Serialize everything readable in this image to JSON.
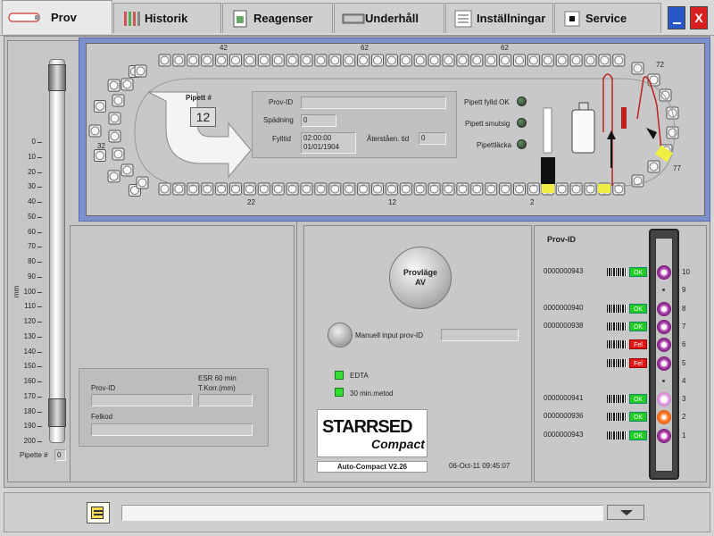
{
  "tabs": [
    {
      "label": "Prov",
      "icon": "sample-tube-icon"
    },
    {
      "label": "Historik",
      "icon": "tubes-history-icon"
    },
    {
      "label": "Reagenser",
      "icon": "reagent-doc-icon"
    },
    {
      "label": "Underhåll",
      "icon": "maintenance-icon"
    },
    {
      "label": "Inställningar",
      "icon": "settings-list-icon"
    },
    {
      "label": "Service",
      "icon": "service-icon"
    }
  ],
  "window": {
    "minimize_icon": "minimize-icon",
    "close_label": "X"
  },
  "conveyor": {
    "top_labels": [
      "42",
      "62",
      "62",
      "72"
    ],
    "left_label": "32",
    "bottom_labels": [
      "22",
      "12",
      "2"
    ],
    "right_label": "77"
  },
  "pipette": {
    "title": "Pipett #",
    "number": "12"
  },
  "info": {
    "prov_id_label": "Prov-ID",
    "prov_id_value": "",
    "spadning_label": "Spädning",
    "spadning_value": "0",
    "fylltid_label": "Fylltid",
    "fylltid_time": "02:00:00",
    "fylltid_date": "01/01/1904",
    "aterstaen_label": "Återståen. tid",
    "aterstaen_value": "0"
  },
  "status": {
    "pipett_fylld": "Pipett fylld OK",
    "pipett_smutsig": "Pipett smutsig",
    "pipettlacka": "Pipettläcka"
  },
  "gauge": {
    "unit": "mm",
    "ticks": [
      "0",
      "10",
      "20",
      "30",
      "40",
      "50",
      "60",
      "70",
      "80",
      "90",
      "100",
      "110",
      "120",
      "130",
      "140",
      "150",
      "160",
      "170",
      "180",
      "190",
      "200"
    ],
    "pipette_label": "Pipette #",
    "pipette_value": "0"
  },
  "result": {
    "prov_id_label": "Prov-ID",
    "esr_label": "ESR 60 min",
    "tkorr_label": "T.Korr.(mm)",
    "felkod_label": "Felkod"
  },
  "control": {
    "provlage_line1": "Provläge",
    "provlage_line2": "AV",
    "manual_label": "Manuell input prov-ID",
    "edta_label": "EDTA",
    "metod_label": "30 min.metod",
    "logo_text": "STARRSED",
    "logo_sub": "Compact",
    "version": "Auto-Compact V2.26",
    "datetime": "06-Oct-11 09:45:07"
  },
  "rack": {
    "header": "Prov-ID",
    "rows": [
      {
        "id": "0000000943",
        "status": "OK",
        "pos": "10",
        "tube": "purple"
      },
      {
        "id": "",
        "status": "",
        "pos": "9",
        "tube": ""
      },
      {
        "id": "0000000940",
        "status": "OK",
        "pos": "8",
        "tube": "purple"
      },
      {
        "id": "0000000938",
        "status": "OK",
        "pos": "7",
        "tube": "purple"
      },
      {
        "id": "",
        "status": "Fel",
        "pos": "6",
        "tube": "purple"
      },
      {
        "id": "",
        "status": "Fel",
        "pos": "5",
        "tube": "purple"
      },
      {
        "id": "",
        "status": "",
        "pos": "4",
        "tube": ""
      },
      {
        "id": "0000000941",
        "status": "OK",
        "pos": "3",
        "tube": "lavender"
      },
      {
        "id": "0000000936",
        "status": "OK",
        "pos": "2",
        "tube": "orange"
      },
      {
        "id": "0000000943",
        "status": "OK",
        "pos": "1",
        "tube": "purple"
      }
    ]
  },
  "bottom": {
    "message_value": "",
    "notepad_icon": "notepad-icon",
    "dropdown_icon": "dropdown-arrow-icon"
  },
  "colors": {
    "ok": "#22cc22",
    "fel": "#e01818",
    "accent_blue": "#7e8fd0",
    "winbtn_blue": "#2857c8",
    "winbtn_red": "#d82020"
  }
}
